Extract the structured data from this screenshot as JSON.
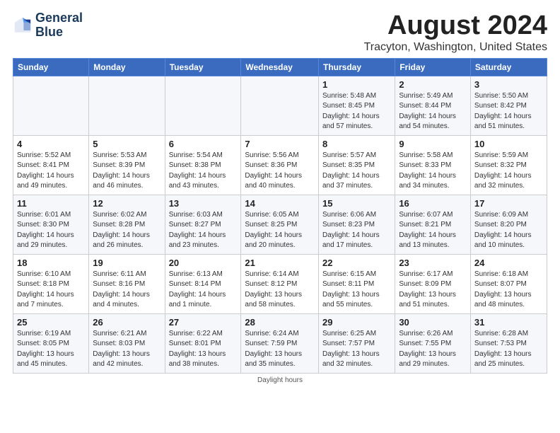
{
  "logo": {
    "line1": "General",
    "line2": "Blue"
  },
  "title": "August 2024",
  "subtitle": "Tracyton, Washington, United States",
  "days_of_week": [
    "Sunday",
    "Monday",
    "Tuesday",
    "Wednesday",
    "Thursday",
    "Friday",
    "Saturday"
  ],
  "footer": "Daylight hours",
  "weeks": [
    [
      {
        "day": "",
        "info": ""
      },
      {
        "day": "",
        "info": ""
      },
      {
        "day": "",
        "info": ""
      },
      {
        "day": "",
        "info": ""
      },
      {
        "day": "1",
        "info": "Sunrise: 5:48 AM\nSunset: 8:45 PM\nDaylight: 14 hours\nand 57 minutes."
      },
      {
        "day": "2",
        "info": "Sunrise: 5:49 AM\nSunset: 8:44 PM\nDaylight: 14 hours\nand 54 minutes."
      },
      {
        "day": "3",
        "info": "Sunrise: 5:50 AM\nSunset: 8:42 PM\nDaylight: 14 hours\nand 51 minutes."
      }
    ],
    [
      {
        "day": "4",
        "info": "Sunrise: 5:52 AM\nSunset: 8:41 PM\nDaylight: 14 hours\nand 49 minutes."
      },
      {
        "day": "5",
        "info": "Sunrise: 5:53 AM\nSunset: 8:39 PM\nDaylight: 14 hours\nand 46 minutes."
      },
      {
        "day": "6",
        "info": "Sunrise: 5:54 AM\nSunset: 8:38 PM\nDaylight: 14 hours\nand 43 minutes."
      },
      {
        "day": "7",
        "info": "Sunrise: 5:56 AM\nSunset: 8:36 PM\nDaylight: 14 hours\nand 40 minutes."
      },
      {
        "day": "8",
        "info": "Sunrise: 5:57 AM\nSunset: 8:35 PM\nDaylight: 14 hours\nand 37 minutes."
      },
      {
        "day": "9",
        "info": "Sunrise: 5:58 AM\nSunset: 8:33 PM\nDaylight: 14 hours\nand 34 minutes."
      },
      {
        "day": "10",
        "info": "Sunrise: 5:59 AM\nSunset: 8:32 PM\nDaylight: 14 hours\nand 32 minutes."
      }
    ],
    [
      {
        "day": "11",
        "info": "Sunrise: 6:01 AM\nSunset: 8:30 PM\nDaylight: 14 hours\nand 29 minutes."
      },
      {
        "day": "12",
        "info": "Sunrise: 6:02 AM\nSunset: 8:28 PM\nDaylight: 14 hours\nand 26 minutes."
      },
      {
        "day": "13",
        "info": "Sunrise: 6:03 AM\nSunset: 8:27 PM\nDaylight: 14 hours\nand 23 minutes."
      },
      {
        "day": "14",
        "info": "Sunrise: 6:05 AM\nSunset: 8:25 PM\nDaylight: 14 hours\nand 20 minutes."
      },
      {
        "day": "15",
        "info": "Sunrise: 6:06 AM\nSunset: 8:23 PM\nDaylight: 14 hours\nand 17 minutes."
      },
      {
        "day": "16",
        "info": "Sunrise: 6:07 AM\nSunset: 8:21 PM\nDaylight: 14 hours\nand 13 minutes."
      },
      {
        "day": "17",
        "info": "Sunrise: 6:09 AM\nSunset: 8:20 PM\nDaylight: 14 hours\nand 10 minutes."
      }
    ],
    [
      {
        "day": "18",
        "info": "Sunrise: 6:10 AM\nSunset: 8:18 PM\nDaylight: 14 hours\nand 7 minutes."
      },
      {
        "day": "19",
        "info": "Sunrise: 6:11 AM\nSunset: 8:16 PM\nDaylight: 14 hours\nand 4 minutes."
      },
      {
        "day": "20",
        "info": "Sunrise: 6:13 AM\nSunset: 8:14 PM\nDaylight: 14 hours\nand 1 minute."
      },
      {
        "day": "21",
        "info": "Sunrise: 6:14 AM\nSunset: 8:12 PM\nDaylight: 13 hours\nand 58 minutes."
      },
      {
        "day": "22",
        "info": "Sunrise: 6:15 AM\nSunset: 8:11 PM\nDaylight: 13 hours\nand 55 minutes."
      },
      {
        "day": "23",
        "info": "Sunrise: 6:17 AM\nSunset: 8:09 PM\nDaylight: 13 hours\nand 51 minutes."
      },
      {
        "day": "24",
        "info": "Sunrise: 6:18 AM\nSunset: 8:07 PM\nDaylight: 13 hours\nand 48 minutes."
      }
    ],
    [
      {
        "day": "25",
        "info": "Sunrise: 6:19 AM\nSunset: 8:05 PM\nDaylight: 13 hours\nand 45 minutes."
      },
      {
        "day": "26",
        "info": "Sunrise: 6:21 AM\nSunset: 8:03 PM\nDaylight: 13 hours\nand 42 minutes."
      },
      {
        "day": "27",
        "info": "Sunrise: 6:22 AM\nSunset: 8:01 PM\nDaylight: 13 hours\nand 38 minutes."
      },
      {
        "day": "28",
        "info": "Sunrise: 6:24 AM\nSunset: 7:59 PM\nDaylight: 13 hours\nand 35 minutes."
      },
      {
        "day": "29",
        "info": "Sunrise: 6:25 AM\nSunset: 7:57 PM\nDaylight: 13 hours\nand 32 minutes."
      },
      {
        "day": "30",
        "info": "Sunrise: 6:26 AM\nSunset: 7:55 PM\nDaylight: 13 hours\nand 29 minutes."
      },
      {
        "day": "31",
        "info": "Sunrise: 6:28 AM\nSunset: 7:53 PM\nDaylight: 13 hours\nand 25 minutes."
      }
    ]
  ]
}
